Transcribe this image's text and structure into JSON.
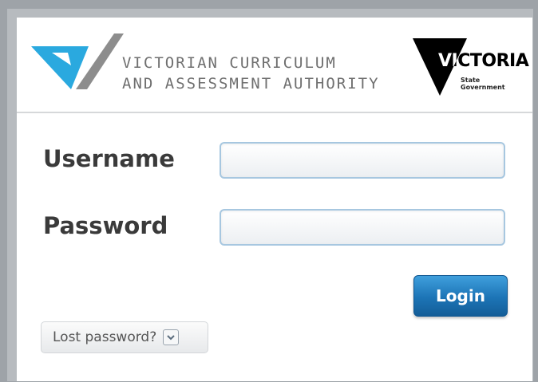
{
  "header": {
    "org_name_line1": "VICTORIAN CURRICULUM",
    "org_name_line2": "AND ASSESSMENT AUTHORITY",
    "gov_logo_word": "VICTORIA",
    "gov_logo_sub_line1": "State",
    "gov_logo_sub_line2": "Government"
  },
  "form": {
    "username_label": "Username",
    "username_value": "",
    "password_label": "Password",
    "password_value": "",
    "login_label": "Login",
    "lost_password_label": "Lost password?"
  },
  "colors": {
    "brand_blue": "#29a8e0",
    "brand_grey": "#8c8c8c",
    "button_blue": "#1c74b6"
  }
}
